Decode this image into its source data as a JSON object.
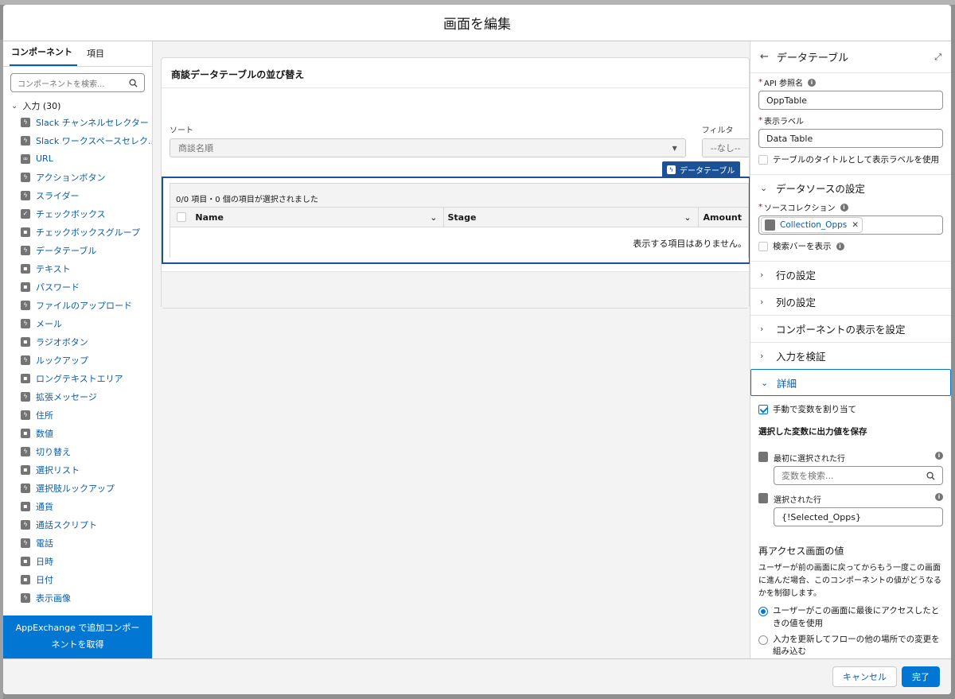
{
  "modal": {
    "title": "画面を編集"
  },
  "left": {
    "tabs": [
      "コンポーネント",
      "項目"
    ],
    "search_placeholder": "コンポーネントを検索...",
    "section": "入力 (30)",
    "items": [
      {
        "label": "Slack チャンネルセレクター",
        "icon": "lightning-icon"
      },
      {
        "label": "Slack ワークスペースセレク...",
        "icon": "lightning-icon"
      },
      {
        "label": "URL",
        "icon": "link-icon"
      },
      {
        "label": "アクションボタン",
        "icon": "lightning-icon"
      },
      {
        "label": "スライダー",
        "icon": "lightning-icon"
      },
      {
        "label": "チェックボックス",
        "icon": "checkbox-icon"
      },
      {
        "label": "チェックボックスグループ",
        "icon": "checkbox-group-icon"
      },
      {
        "label": "データテーブル",
        "icon": "lightning-icon"
      },
      {
        "label": "テキスト",
        "icon": "text-icon"
      },
      {
        "label": "パスワード",
        "icon": "password-icon"
      },
      {
        "label": "ファイルのアップロード",
        "icon": "lightning-icon"
      },
      {
        "label": "メール",
        "icon": "lightning-icon"
      },
      {
        "label": "ラジオボタン",
        "icon": "radio-icon"
      },
      {
        "label": "ルックアップ",
        "icon": "lightning-icon"
      },
      {
        "label": "ロングテキストエリア",
        "icon": "textarea-icon"
      },
      {
        "label": "拡張メッセージ",
        "icon": "lightning-icon"
      },
      {
        "label": "住所",
        "icon": "lightning-icon"
      },
      {
        "label": "数値",
        "icon": "number-icon"
      },
      {
        "label": "切り替え",
        "icon": "lightning-icon"
      },
      {
        "label": "選択リスト",
        "icon": "picklist-icon"
      },
      {
        "label": "選択肢ルックアップ",
        "icon": "lightning-icon"
      },
      {
        "label": "通貨",
        "icon": "currency-icon"
      },
      {
        "label": "通話スクリプト",
        "icon": "lightning-icon"
      },
      {
        "label": "電話",
        "icon": "lightning-icon"
      },
      {
        "label": "日時",
        "icon": "datetime-icon"
      },
      {
        "label": "日付",
        "icon": "date-icon"
      },
      {
        "label": "表示画像",
        "icon": "lightning-icon"
      }
    ],
    "appexchange_button": "AppExchange で追加コンポーネントを取得"
  },
  "canvas": {
    "card_title": "商談データテーブルの並び替え",
    "sort_label": "ソート",
    "sort_value": "商談名順",
    "filter_label": "フィルタ",
    "filter_value": "--なし--",
    "badge": "データテーブル",
    "table_status": "0/0 項目・0 個の項目が選択されました",
    "columns": [
      "Name",
      "Stage",
      "Amount"
    ],
    "empty_text": "表示する項目はありません。"
  },
  "right": {
    "title": "データテーブル",
    "api_label": "API 参照名",
    "api_value": "OppTable",
    "display_label_label": "表示ラベル",
    "display_label_value": "Data Table",
    "use_title_checkbox": "テーブルのタイトルとして表示ラベルを使用",
    "source_section": "データソースの設定",
    "source_collection_label": "ソースコレクション",
    "source_collection_pill": "Collection_Opps",
    "search_bar_checkbox": "検索バーを表示",
    "row_section": "行の設定",
    "col_section": "列の設定",
    "visibility_section": "コンポーネントの表示を設定",
    "validate_section": "入力を検証",
    "detail_section": "詳細",
    "manual_assign": "手動で変数を割り当て",
    "store_output_head": "選択した変数に出力値を保存",
    "first_row_label": "最初に選択された行",
    "first_row_placeholder": "変数を検索...",
    "selected_rows_label": "選択された行",
    "selected_rows_value": "{!Selected_Opps}",
    "revisit_head": "再アクセス画面の値",
    "revisit_desc": "ユーザーが前の画面に戻ってからもう一度この画面に進んだ場合、このコンポーネントの値がどうなるかを制御します。",
    "radio1": "ユーザーがこの画面に最後にアクセスしたときの値を使用",
    "radio2": "入力を更新してフローの他の場所での変更を組み込む"
  },
  "footer": {
    "cancel": "キャンセル",
    "done": "完了"
  },
  "colors": {
    "brand": "#0176d3",
    "link": "#0b5cab",
    "badge": "#1b5297"
  }
}
